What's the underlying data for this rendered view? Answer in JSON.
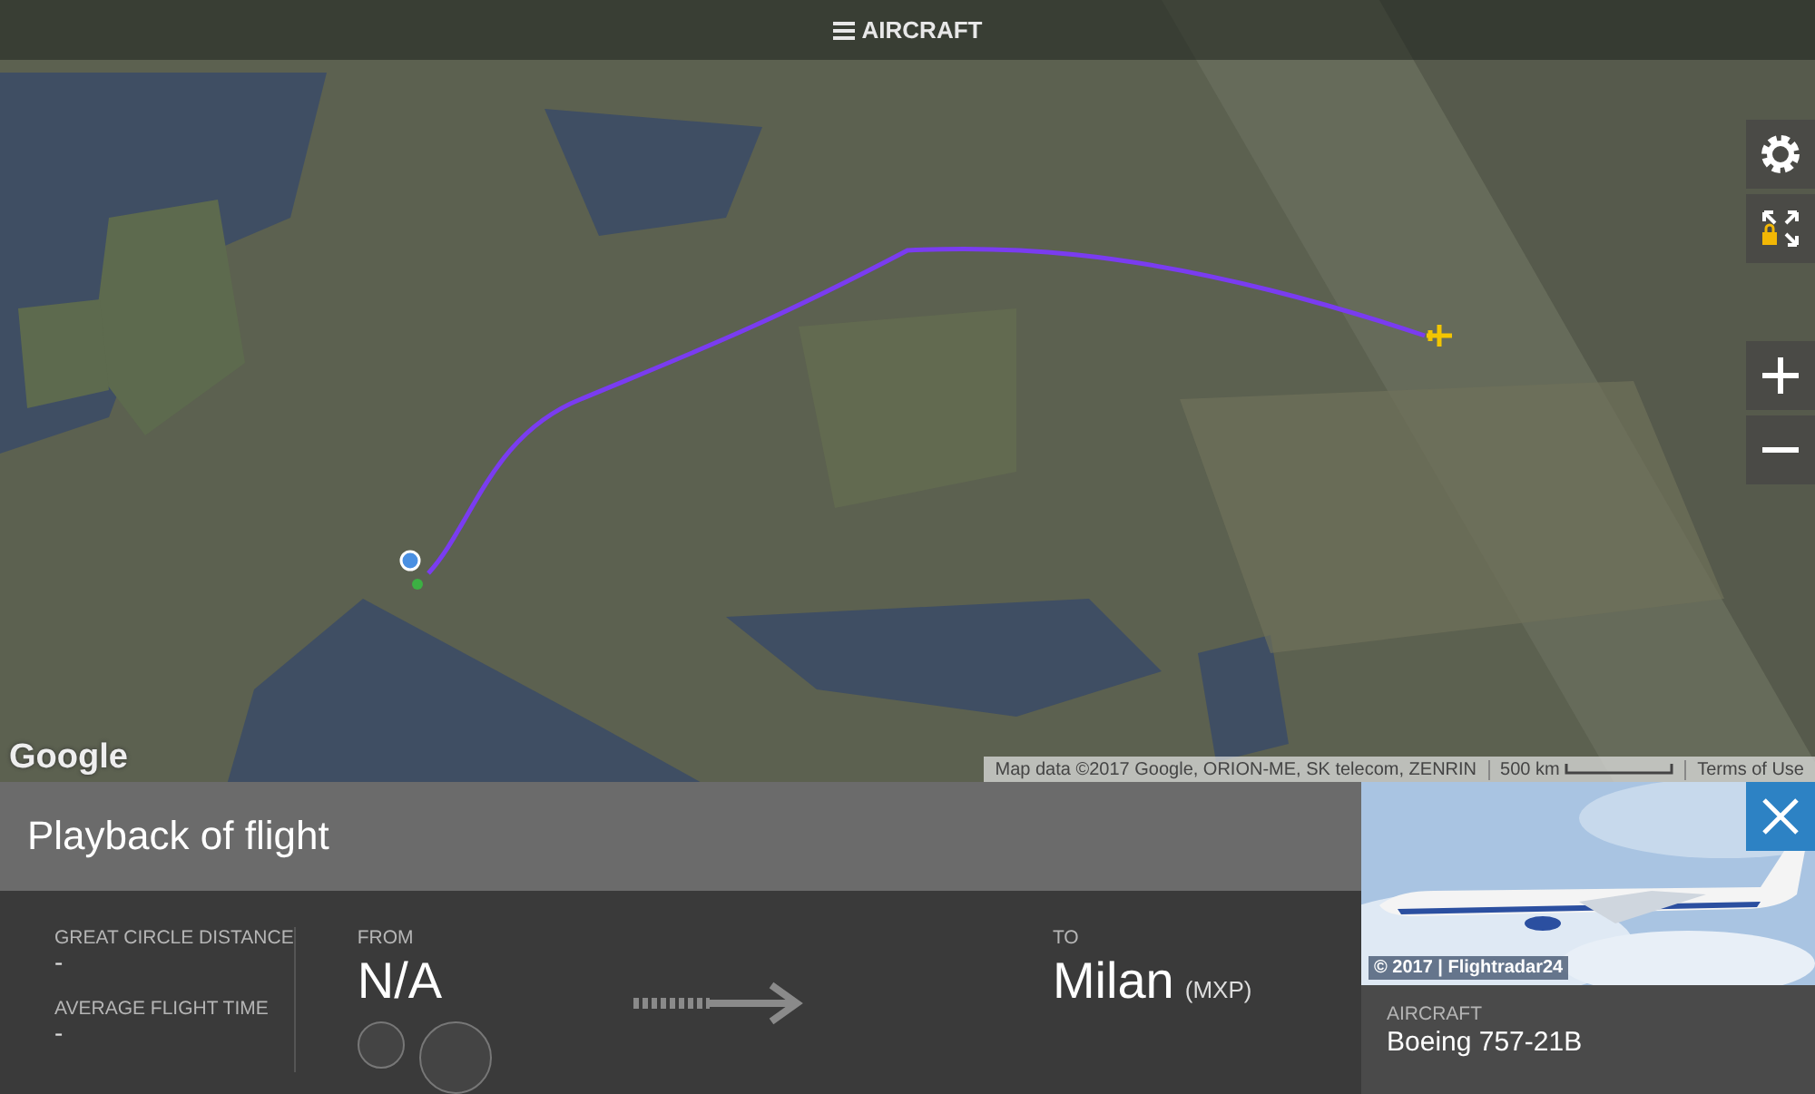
{
  "top_bar": {
    "title": "AIRCRAFT"
  },
  "map": {
    "logo": "Google",
    "attribution": "Map data ©2017 Google, ORION-ME, SK telecom, ZENRIN",
    "scale": "500 km",
    "terms": "Terms of Use"
  },
  "playback": {
    "title": "Playback of flight"
  },
  "stats": [
    {
      "label": "GREAT CIRCLE DISTANCE",
      "value": "-"
    },
    {
      "label": "AVERAGE FLIGHT TIME",
      "value": "-"
    }
  ],
  "from": {
    "label": "FROM",
    "value": "N/A"
  },
  "to": {
    "label": "TO",
    "city": "Milan",
    "code": "(MXP)"
  },
  "aircraft": {
    "photo_credit": "© 2017 | Flightradar24",
    "label": "AIRCRAFT",
    "value": "Boeing 757-21B"
  }
}
